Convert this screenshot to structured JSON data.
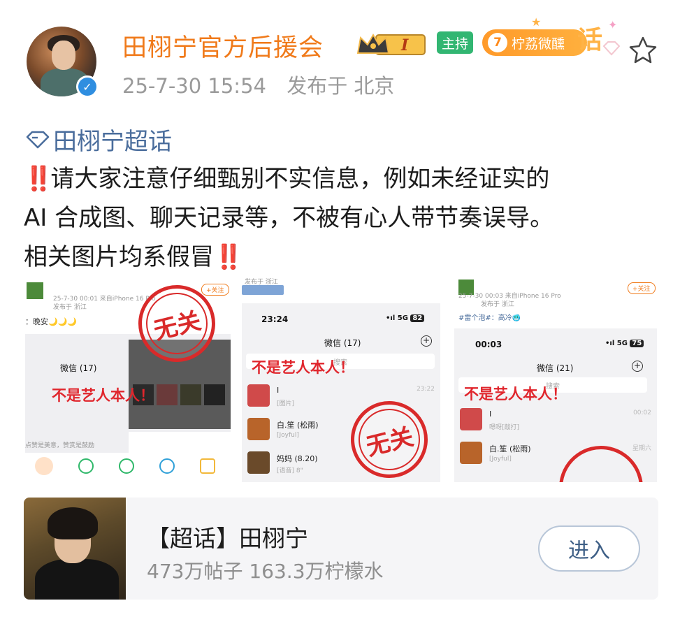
{
  "post": {
    "author": "田栩宁官方后援会",
    "timestamp": "25-7-30 15:54",
    "location": "发布于 北京",
    "badges": {
      "crown_label": "I",
      "host_label": "主持",
      "fan_level": "7",
      "fan_label": "柠荔微醺",
      "topic_glyph": "话"
    },
    "topic": "田栩宁超话",
    "text_line1": "请大家注意仔细甄别不实信息，例如未经证实的",
    "text_line2": "AI 合成图、聊天记录等，不被有心人带节奏误导。",
    "text_line3": "相关图片均系假冒",
    "bang": "‼️"
  },
  "images": [
    {
      "meta": "25-7-30 00:01  来自iPhone 16 Pro",
      "meta2": "发布于 浙江",
      "follow": "+关注",
      "caption": "：晚安🌙🌙🌙",
      "wechat_title": "微信 (17)",
      "note": "不是艺人本人！",
      "stamp": "无关",
      "footer": "点赞是美意，赞赏是鼓励"
    },
    {
      "meta": "发布于 浙江",
      "time": "23:24",
      "signal": "5G",
      "battery": "82",
      "wechat_title": "微信 (17)",
      "search": "搜索",
      "note": "不是艺人本人！",
      "stamp": "无关",
      "chats": [
        {
          "name": "I",
          "msg": "[图片]",
          "time": "23:22"
        },
        {
          "name": "白.笙 (松雨)",
          "msg": "[Joyful]",
          "time": ""
        },
        {
          "name": "妈妈 (8.20)",
          "msg": "[语音] 8\"",
          "time": ""
        }
      ]
    },
    {
      "meta": "25-7-30 00:03  来自iPhone 16 Pro",
      "meta2": "发布于 浙江",
      "follow": "+关注",
      "caption": "#雷个泡#：高冷🥶",
      "time": "00:03",
      "signal": "5G",
      "battery": "75",
      "wechat_title": "微信 (21)",
      "search": "搜索",
      "note": "不是艺人本人！",
      "chats": [
        {
          "name": "I",
          "msg": "嗯呀[敲打]",
          "time": "00:02"
        },
        {
          "name": "白.笙 (松雨)",
          "msg": "[Joyful]",
          "time": "星期六"
        }
      ]
    }
  ],
  "card": {
    "title": "【超话】田栩宁",
    "stats": "473万帖子 163.3万柠檬水",
    "button": "进入"
  },
  "colors": {
    "username": "#f07a1a",
    "topic": "#4a6d9c",
    "alert_red": "#e0262d",
    "host_green": "#32b672"
  }
}
